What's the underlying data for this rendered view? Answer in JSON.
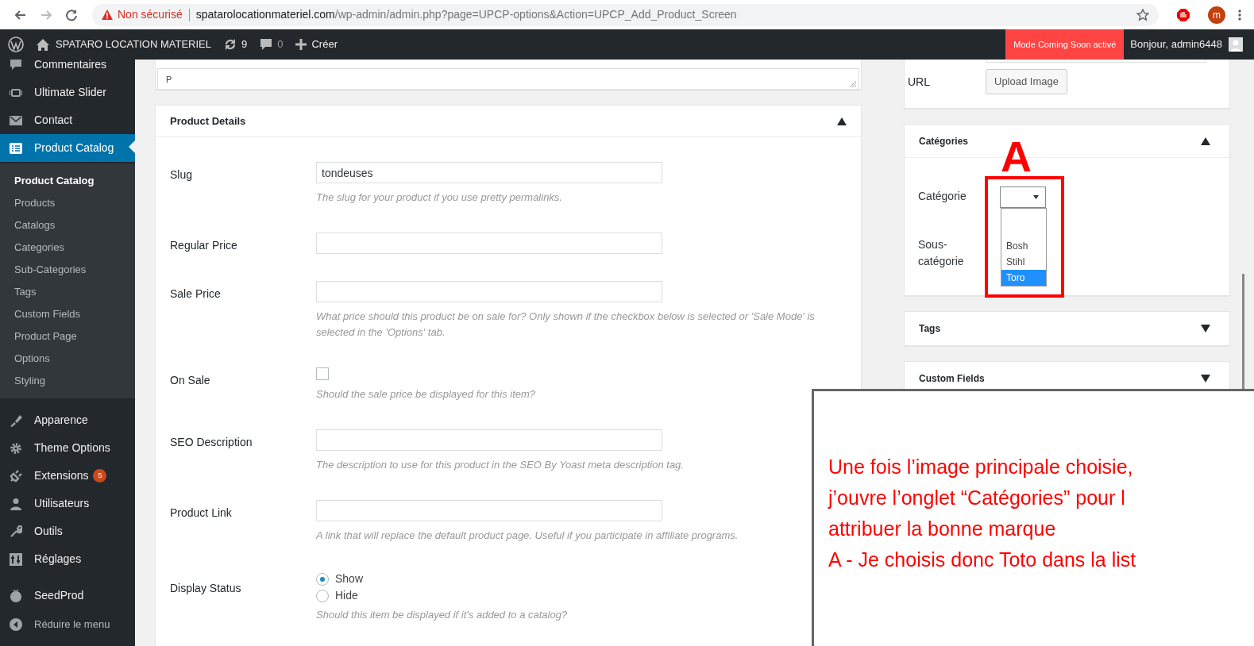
{
  "browser": {
    "security_label": "Non sécurisé",
    "url_host": "spatarolocationmateriel.com",
    "url_path": "/wp-admin/admin.php?page=UPCP-options&Action=UPCP_Add_Product_Screen",
    "profile_initial": "m"
  },
  "admin_bar": {
    "site_name": "SPATARO LOCATION MATERIEL",
    "updates": "9",
    "comments": "0",
    "new_label": "Créer",
    "notice": "Mode Coming Soon activé",
    "greeting": "Bonjour, admin6448"
  },
  "sidebar": {
    "menu_groups": [
      [
        {
          "label": "Commentaires",
          "selected": false
        },
        {
          "label": "Ultimate Slider",
          "selected": false
        },
        {
          "label": "Contact",
          "selected": false
        },
        {
          "label": "Product Catalog",
          "selected": true,
          "children": [
            {
              "label": "Product Catalog",
              "selected": true
            },
            {
              "label": "Products",
              "selected": false
            },
            {
              "label": "Catalogs",
              "selected": false
            },
            {
              "label": "Categories",
              "selected": false
            },
            {
              "label": "Sub-Categories",
              "selected": false
            },
            {
              "label": "Tags",
              "selected": false
            },
            {
              "label": "Custom Fields",
              "selected": false
            },
            {
              "label": "Product Page",
              "selected": false
            },
            {
              "label": "Options",
              "selected": false
            },
            {
              "label": "Styling",
              "selected": false
            }
          ]
        },
        {
          "label": "Apparence",
          "selected": false
        },
        {
          "label": "Theme Options",
          "selected": false
        },
        {
          "label": "Extensions",
          "selected": false,
          "badge": "5"
        },
        {
          "label": "Utilisateurs",
          "selected": false
        },
        {
          "label": "Outils",
          "selected": false
        },
        {
          "label": "Réglages",
          "selected": false
        }
      ],
      [
        {
          "label": "SeedProd",
          "selected": false
        }
      ]
    ],
    "collapse_label": "Réduire le menu"
  },
  "main": {
    "editor": {
      "value": "P"
    },
    "product_details": {
      "title": "Product Details",
      "expanded": true,
      "fields": [
        {
          "kind": "text",
          "label": "Slug",
          "value": "tondeuses",
          "help": "The slug for your product if you use pretty permalinks."
        },
        {
          "kind": "text",
          "label": "Regular Price"
        },
        {
          "kind": "text",
          "label": "Sale Price",
          "help": "What price should this product be on sale for? Only shown if the checkbox below is selected or 'Sale Mode' is selected in the 'Options' tab."
        },
        {
          "kind": "checkbox",
          "label": "On Sale",
          "checked": false,
          "help": "Should the sale price be displayed for this item?"
        },
        {
          "kind": "text",
          "label": "SEO Description",
          "help": "The description to use for this product in the SEO By Yoast meta description tag."
        },
        {
          "kind": "text",
          "label": "Product Link",
          "help": "A link that will replace the default product page. Useful if you participate in affiliate programs."
        },
        {
          "kind": "radio",
          "label": "Display Status",
          "options": [
            {
              "label": "Show",
              "selected": true
            },
            {
              "label": "Hide",
              "selected": false
            }
          ],
          "help": "Should this item be displayed if it's added to a catalog?"
        }
      ]
    }
  },
  "side": {
    "image": {
      "label": "URL",
      "button": "Upload Image"
    },
    "panels": [
      {
        "title": "Catégories",
        "expanded": true,
        "fields": [
          {
            "label": "Catégorie",
            "dropdown": {
              "open": true,
              "options": [
                {
                  "label": "Bosh",
                  "selected": false
                },
                {
                  "label": "Stihl",
                  "selected": false
                },
                {
                  "label": "Toro",
                  "selected": true
                }
              ]
            }
          },
          {
            "label": "Sous-catégorie"
          }
        ]
      },
      {
        "title": "Tags",
        "expanded": false
      },
      {
        "title": "Custom Fields",
        "expanded": false
      }
    ]
  },
  "annotation": {
    "marker": "A",
    "note": [
      "Une fois l’image principale choisie,",
      "j’ouvre l’onglet “Catégories” pour l",
      "attribuer la bonne marque",
      "A - Je choisis donc Toto dans la list"
    ]
  }
}
